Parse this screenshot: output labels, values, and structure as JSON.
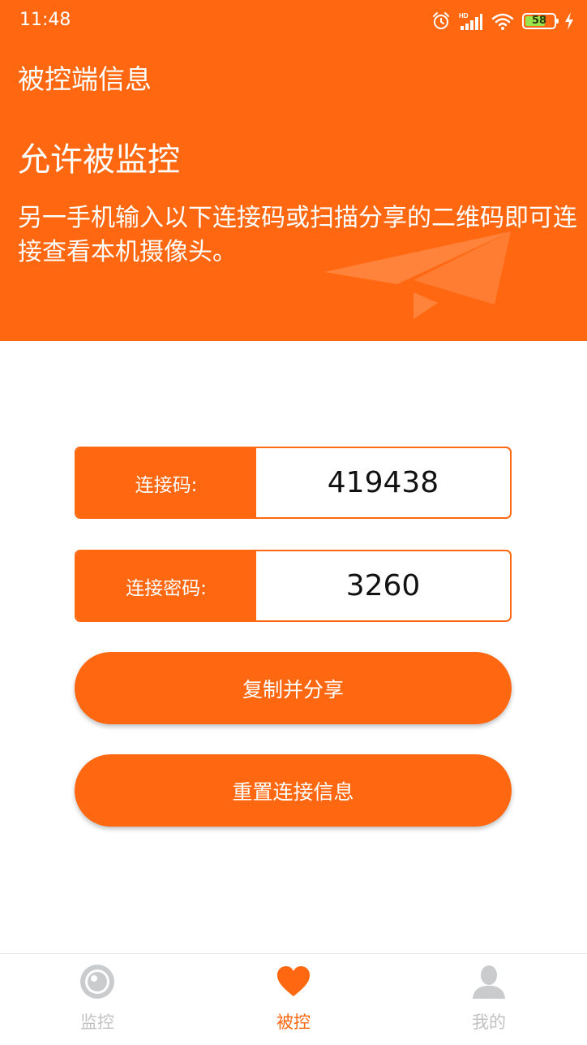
{
  "status_bar": {
    "time": "11:48",
    "icons": [
      "alarm-icon",
      "hd-signal-icon",
      "wifi-icon",
      "battery-icon",
      "charging-icon"
    ],
    "battery_level": "58",
    "hd_label": "HD"
  },
  "header": {
    "app_title": "被控端信息",
    "headline": "允许被监控",
    "description": "另一手机输入以下连接码或扫描分享的二维码即可连接查看本机摄像头。",
    "decoration_icon": "paper-plane-icon",
    "background_color": "#ff6811"
  },
  "connection": {
    "code_label": "连接码:",
    "code_value": "419438",
    "password_label": "连接密码:",
    "password_value": "3260"
  },
  "actions": {
    "copy_share_label": "复制并分享",
    "reset_label": "重置连接信息"
  },
  "bottom_nav": {
    "items": [
      {
        "label": "监控",
        "icon": "camera-eye-icon",
        "active": false
      },
      {
        "label": "被控",
        "icon": "heart-icon",
        "active": true
      },
      {
        "label": "我的",
        "icon": "user-icon",
        "active": false
      }
    ],
    "active_color": "#ff6811",
    "inactive_color": "#c2c2c2"
  }
}
